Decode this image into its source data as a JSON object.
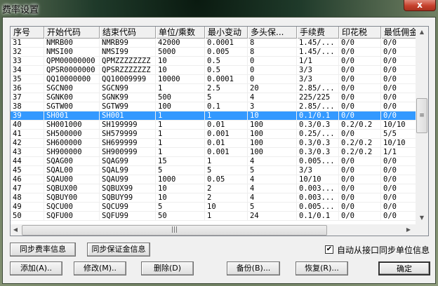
{
  "window": {
    "title": "费率设置",
    "close": "x"
  },
  "table": {
    "columns": [
      "序号",
      "开始代码",
      "结束代码",
      "单位/乘数",
      "最小变动",
      "多头保...",
      "手续费",
      "印花税",
      "最低佣金"
    ],
    "selected_index": 8,
    "rows": [
      [
        "31",
        "NMRB00",
        "NMRB99",
        "42000",
        "0.0001",
        "8",
        "1.45/...",
        "0/0",
        "0/0"
      ],
      [
        "32",
        "NMSI00",
        "NMSI99",
        "5000",
        "0.005",
        "8",
        "1.45/...",
        "0/0",
        "0/0"
      ],
      [
        "33",
        "QPM00000000",
        "QPMZZZZZZZZ",
        "10",
        "0.5",
        "0",
        "1/1",
        "0/0",
        "0/0"
      ],
      [
        "34",
        "QPSR0000000",
        "QPSRZZZZZZZ",
        "10",
        "0.5",
        "0",
        "3/3",
        "0/0",
        "0/0"
      ],
      [
        "35",
        "QQ10000000",
        "QQ10009999",
        "10000",
        "0.0001",
        "0",
        "3/3",
        "0/0",
        "0/0"
      ],
      [
        "36",
        "SGCN00",
        "SGCN99",
        "1",
        "2.5",
        "20",
        "2.85/...",
        "0/0",
        "0/0"
      ],
      [
        "37",
        "SGNK00",
        "SGNK99",
        "500",
        "5",
        "4",
        "225/225",
        "0/0",
        "0/0"
      ],
      [
        "38",
        "SGTW00",
        "SGTW99",
        "100",
        "0.1",
        "3",
        "2.85/...",
        "0/0",
        "0/0"
      ],
      [
        "39",
        "SH001",
        "SH001",
        "1",
        "1",
        "10",
        "0.1/0.1",
        "0/0",
        "0/0"
      ],
      [
        "40",
        "SH001000",
        "SH199999",
        "1",
        "0.01",
        "100",
        "0.3/0.3",
        "0.2/0.2",
        "10/10"
      ],
      [
        "41",
        "SH500000",
        "SH579999",
        "1",
        "0.001",
        "100",
        "0.25/...",
        "0/0",
        "5/5"
      ],
      [
        "42",
        "SH600000",
        "SH699999",
        "1",
        "0.01",
        "100",
        "0.3/0.3",
        "0.2/0.2",
        "10/10"
      ],
      [
        "43",
        "SH900000",
        "SH900999",
        "1",
        "0.001",
        "100",
        "0.3/0.3",
        "0.2/0.2",
        "1/1"
      ],
      [
        "44",
        "SQAG00",
        "SQAG99",
        "15",
        "1",
        "4",
        "0.005...",
        "0/0",
        "0/0"
      ],
      [
        "45",
        "SQAL00",
        "SQAL99",
        "5",
        "5",
        "5",
        "3/3",
        "0/0",
        "0/0"
      ],
      [
        "46",
        "SQAU00",
        "SQAU99",
        "1000",
        "0.05",
        "4",
        "10/10",
        "0/0",
        "0/0"
      ],
      [
        "47",
        "SQBUX00",
        "SQBUX99",
        "10",
        "2",
        "4",
        "0.003...",
        "0/0",
        "0/0"
      ],
      [
        "48",
        "SQBUY00",
        "SQBUY99",
        "10",
        "2",
        "4",
        "0.003...",
        "0/0",
        "0/0"
      ],
      [
        "49",
        "SQCU00",
        "SQCU99",
        "5",
        "10",
        "5",
        "0.005...",
        "0/0",
        "0/0"
      ],
      [
        "50",
        "SQFU00",
        "SQFU99",
        "50",
        "1",
        "24",
        "0.1/0.1",
        "0/0",
        "0/0"
      ]
    ]
  },
  "buttons": {
    "sync_fee": "同步费率信息",
    "sync_margin": "同步保证金信息",
    "add": "添加(A)..",
    "modify": "修改(M)..",
    "delete": "删除(D)",
    "backup": "备份(B)...",
    "restore": "恢复(R)...",
    "ok": "确定"
  },
  "auto_sync": {
    "label": "自动从接口同步单位信息",
    "checked": true,
    "mark": "✔"
  }
}
